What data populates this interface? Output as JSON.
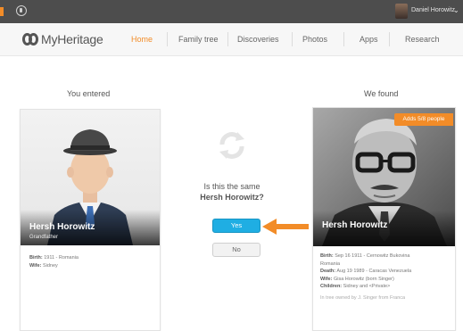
{
  "topbar": {
    "username": "Daniel Horowitz"
  },
  "logo": {
    "text": "MyHeritage"
  },
  "nav": {
    "items": [
      {
        "label": "Home",
        "active": true
      },
      {
        "label": "Family tree"
      },
      {
        "label": "Discoveries"
      },
      {
        "label": "Photos"
      },
      {
        "label": "Apps"
      },
      {
        "label": "Research"
      }
    ]
  },
  "left": {
    "heading": "You entered",
    "name": "Hersh Horowitz",
    "relation": "Grandfather",
    "birth_label": "Birth:",
    "birth_value": "1911 - Romania",
    "wife_label": "Wife:",
    "wife_value": "Sidney"
  },
  "right": {
    "heading": "We found",
    "badge": "Adds 5/8 people",
    "name": "Hersh Horowitz",
    "birth_label": "Birth:",
    "birth_value": "Sep 16 1911 - Cernowitz Bukovina",
    "birth_value2": "Romania",
    "death_label": "Death:",
    "death_value": "Aug 19 1989 - Caracas Venezuela",
    "wife_label": "Wife:",
    "wife_value": "Gisa Horowitz (born Singer)",
    "children_label": "Children:",
    "children_value": "Sidney and <Private>",
    "source": "In tree owned by J. Singer from Franca"
  },
  "question": {
    "line1": "Is this the same",
    "name": "Hersh Horowitz?"
  },
  "buttons": {
    "yes": "Yes",
    "no": "No"
  },
  "colors": {
    "accent": "#f28c28",
    "yes_blue": "#1faee3"
  }
}
